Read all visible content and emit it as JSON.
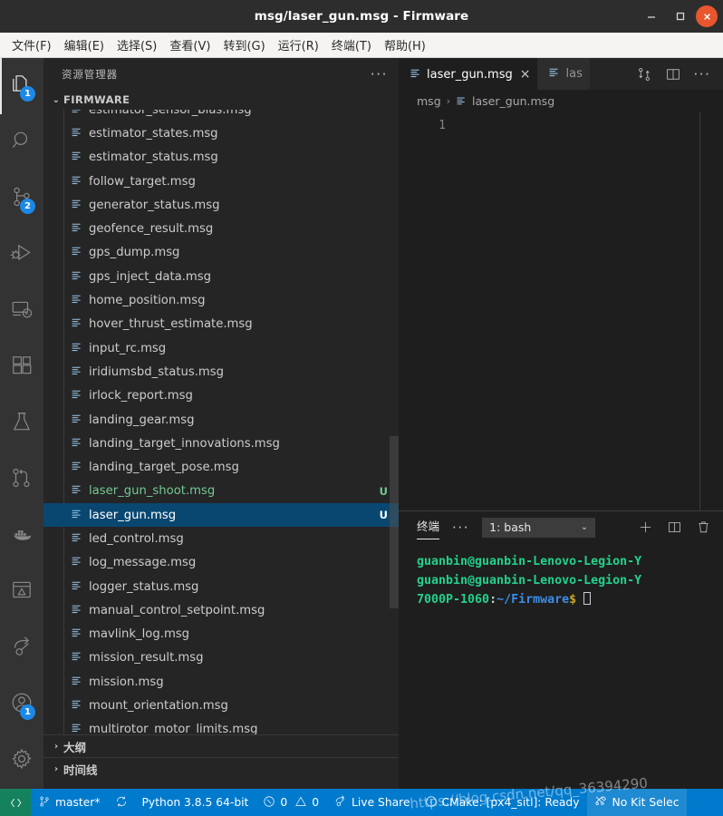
{
  "window": {
    "title": "msg/laser_gun.msg - Firmware",
    "minimize_label": "Minimize",
    "maximize_label": "Maximize",
    "close_label": "Close",
    "titlebar_bg": "#2d2d2d",
    "close_color": "#e8562d"
  },
  "menubar": {
    "items": [
      {
        "label": "文件(F)"
      },
      {
        "label": "编辑(E)"
      },
      {
        "label": "选择(S)"
      },
      {
        "label": "查看(V)"
      },
      {
        "label": "转到(G)"
      },
      {
        "label": "运行(R)"
      },
      {
        "label": "终端(T)"
      },
      {
        "label": "帮助(H)"
      }
    ]
  },
  "activitybar": {
    "items": [
      {
        "name": "explorer",
        "icon": "files-icon",
        "badge": "1",
        "active": true
      },
      {
        "name": "search",
        "icon": "search-icon",
        "badge": "",
        "active": false
      },
      {
        "name": "source-control",
        "icon": "source-control-icon",
        "badge": "2",
        "active": false
      },
      {
        "name": "run-and-debug",
        "icon": "run-debug-icon",
        "badge": "",
        "active": false
      },
      {
        "name": "remote-explorer",
        "icon": "remote-explorer-icon",
        "badge": "",
        "active": false
      },
      {
        "name": "extensions",
        "icon": "extensions-icon",
        "badge": "",
        "active": false
      },
      {
        "name": "testing",
        "icon": "beaker-icon",
        "badge": "",
        "active": false
      },
      {
        "name": "git-graph",
        "icon": "git-graph-icon",
        "badge": "",
        "active": false
      },
      {
        "name": "docker",
        "icon": "docker-icon",
        "badge": "",
        "active": false
      },
      {
        "name": "cmake",
        "icon": "cmake-icon",
        "badge": "",
        "active": false
      },
      {
        "name": "live-share",
        "icon": "live-share-icon",
        "badge": "",
        "active": false
      },
      {
        "name": "accounts",
        "icon": "account-icon",
        "badge": "1",
        "active": false
      },
      {
        "name": "settings",
        "icon": "gear-icon",
        "badge": "",
        "active": false
      }
    ],
    "remote_icon": "remote-indicator-icon",
    "badge_color": "#1d88e5"
  },
  "sidebar": {
    "title": "资源管理器",
    "more_actions": "···",
    "section": {
      "label": "FIRMWARE",
      "expanded": true
    },
    "files": [
      {
        "name": "estimator_sensor_bias.msg",
        "status": "",
        "state": "normal",
        "partial": true
      },
      {
        "name": "estimator_states.msg",
        "status": "",
        "state": "normal"
      },
      {
        "name": "estimator_status.msg",
        "status": "",
        "state": "normal"
      },
      {
        "name": "follow_target.msg",
        "status": "",
        "state": "normal"
      },
      {
        "name": "generator_status.msg",
        "status": "",
        "state": "normal"
      },
      {
        "name": "geofence_result.msg",
        "status": "",
        "state": "normal"
      },
      {
        "name": "gps_dump.msg",
        "status": "",
        "state": "normal"
      },
      {
        "name": "gps_inject_data.msg",
        "status": "",
        "state": "normal"
      },
      {
        "name": "home_position.msg",
        "status": "",
        "state": "normal"
      },
      {
        "name": "hover_thrust_estimate.msg",
        "status": "",
        "state": "normal"
      },
      {
        "name": "input_rc.msg",
        "status": "",
        "state": "normal"
      },
      {
        "name": "iridiumsbd_status.msg",
        "status": "",
        "state": "normal"
      },
      {
        "name": "irlock_report.msg",
        "status": "",
        "state": "normal"
      },
      {
        "name": "landing_gear.msg",
        "status": "",
        "state": "normal"
      },
      {
        "name": "landing_target_innovations.msg",
        "status": "",
        "state": "normal"
      },
      {
        "name": "landing_target_pose.msg",
        "status": "",
        "state": "normal"
      },
      {
        "name": "laser_gun_shoot.msg",
        "status": "U",
        "state": "untracked"
      },
      {
        "name": "laser_gun.msg",
        "status": "U",
        "state": "selected"
      },
      {
        "name": "led_control.msg",
        "status": "",
        "state": "normal"
      },
      {
        "name": "log_message.msg",
        "status": "",
        "state": "normal"
      },
      {
        "name": "logger_status.msg",
        "status": "",
        "state": "normal"
      },
      {
        "name": "manual_control_setpoint.msg",
        "status": "",
        "state": "normal"
      },
      {
        "name": "mavlink_log.msg",
        "status": "",
        "state": "normal"
      },
      {
        "name": "mission_result.msg",
        "status": "",
        "state": "normal"
      },
      {
        "name": "mission.msg",
        "status": "",
        "state": "normal"
      },
      {
        "name": "mount_orientation.msg",
        "status": "",
        "state": "normal"
      },
      {
        "name": "multirotor_motor_limits.msg",
        "status": "",
        "state": "normal",
        "partial": true
      }
    ],
    "bottom_panels": [
      {
        "label": "大纲",
        "expanded": false
      },
      {
        "label": "时间线",
        "expanded": false
      }
    ],
    "untracked_color": "#73c991",
    "selected_bg": "#094771"
  },
  "editor": {
    "tabs": [
      {
        "label": "laser_gun.msg",
        "icon": "msg-file-icon",
        "active": true,
        "close_label": "×"
      },
      {
        "label": "las",
        "icon": "msg-file-icon",
        "active": false,
        "close_label": ""
      }
    ],
    "actions": [
      {
        "name": "open-changes-button",
        "icon": "source-control-icon"
      },
      {
        "name": "split-editor-button",
        "icon": "split-editor-icon"
      },
      {
        "name": "more-actions-button",
        "icon": "more-icon",
        "label": "···"
      }
    ],
    "breadcrumb": [
      {
        "label": "msg",
        "icon": ""
      },
      {
        "label": "laser_gun.msg",
        "icon": "msg-file-icon"
      }
    ],
    "breadcrumb_separator": "›",
    "line_numbers": [
      "1"
    ],
    "content": ""
  },
  "panel": {
    "tab_label": "终端",
    "more_label": "···",
    "terminal_select": {
      "value": "1: bash",
      "chevron": "⌄"
    },
    "actions": [
      {
        "name": "new-terminal-button",
        "icon": "plus-icon"
      },
      {
        "name": "split-terminal-button",
        "icon": "split-icon"
      },
      {
        "name": "kill-terminal-button",
        "icon": "trash-icon"
      }
    ],
    "terminal_lines": [
      {
        "segments": [
          {
            "text": "guanbin@guanbin-Lenovo-Legion-Y",
            "color": "green"
          }
        ]
      },
      {
        "segments": [
          {
            "text": "guanbin@guanbin-Lenovo-Legion-Y",
            "color": "green"
          }
        ]
      },
      {
        "segments": [
          {
            "text": "7000P-1060",
            "color": "green"
          },
          {
            "text": ":",
            "color": "white"
          },
          {
            "text": "~/Firmware",
            "color": "blue"
          },
          {
            "text": "$ ",
            "color": "yellow"
          }
        ],
        "cursor": true
      }
    ],
    "colors": {
      "green": "#23d18b",
      "blue": "#3b8eea",
      "yellow": "#c9a227",
      "white": "#cccccc"
    }
  },
  "statusbar": {
    "remote_icon": "remote-indicator-icon",
    "items": [
      {
        "name": "branch",
        "icon": "git-branch-icon",
        "label": "master*"
      },
      {
        "name": "sync",
        "icon": "sync-icon",
        "label": ""
      },
      {
        "name": "python-interpreter",
        "icon": "",
        "label": "Python 3.8.5 64-bit"
      },
      {
        "name": "problems",
        "icon": "error-warning-icon",
        "label": "0",
        "label2": "0"
      },
      {
        "name": "live-share",
        "icon": "live-share-icon",
        "label": "Live Share"
      },
      {
        "name": "cmake-status",
        "icon": "info-icon",
        "label": "CMake: [px4_sitl]: Ready"
      },
      {
        "name": "cmake-kit",
        "icon": "tools-icon",
        "label": "No Kit Selec",
        "hover": true
      }
    ],
    "bg": "#007acc",
    "remote_bg": "#16825d"
  },
  "watermark": {
    "text": "https://blog.csdn.net/qq_36394290"
  }
}
